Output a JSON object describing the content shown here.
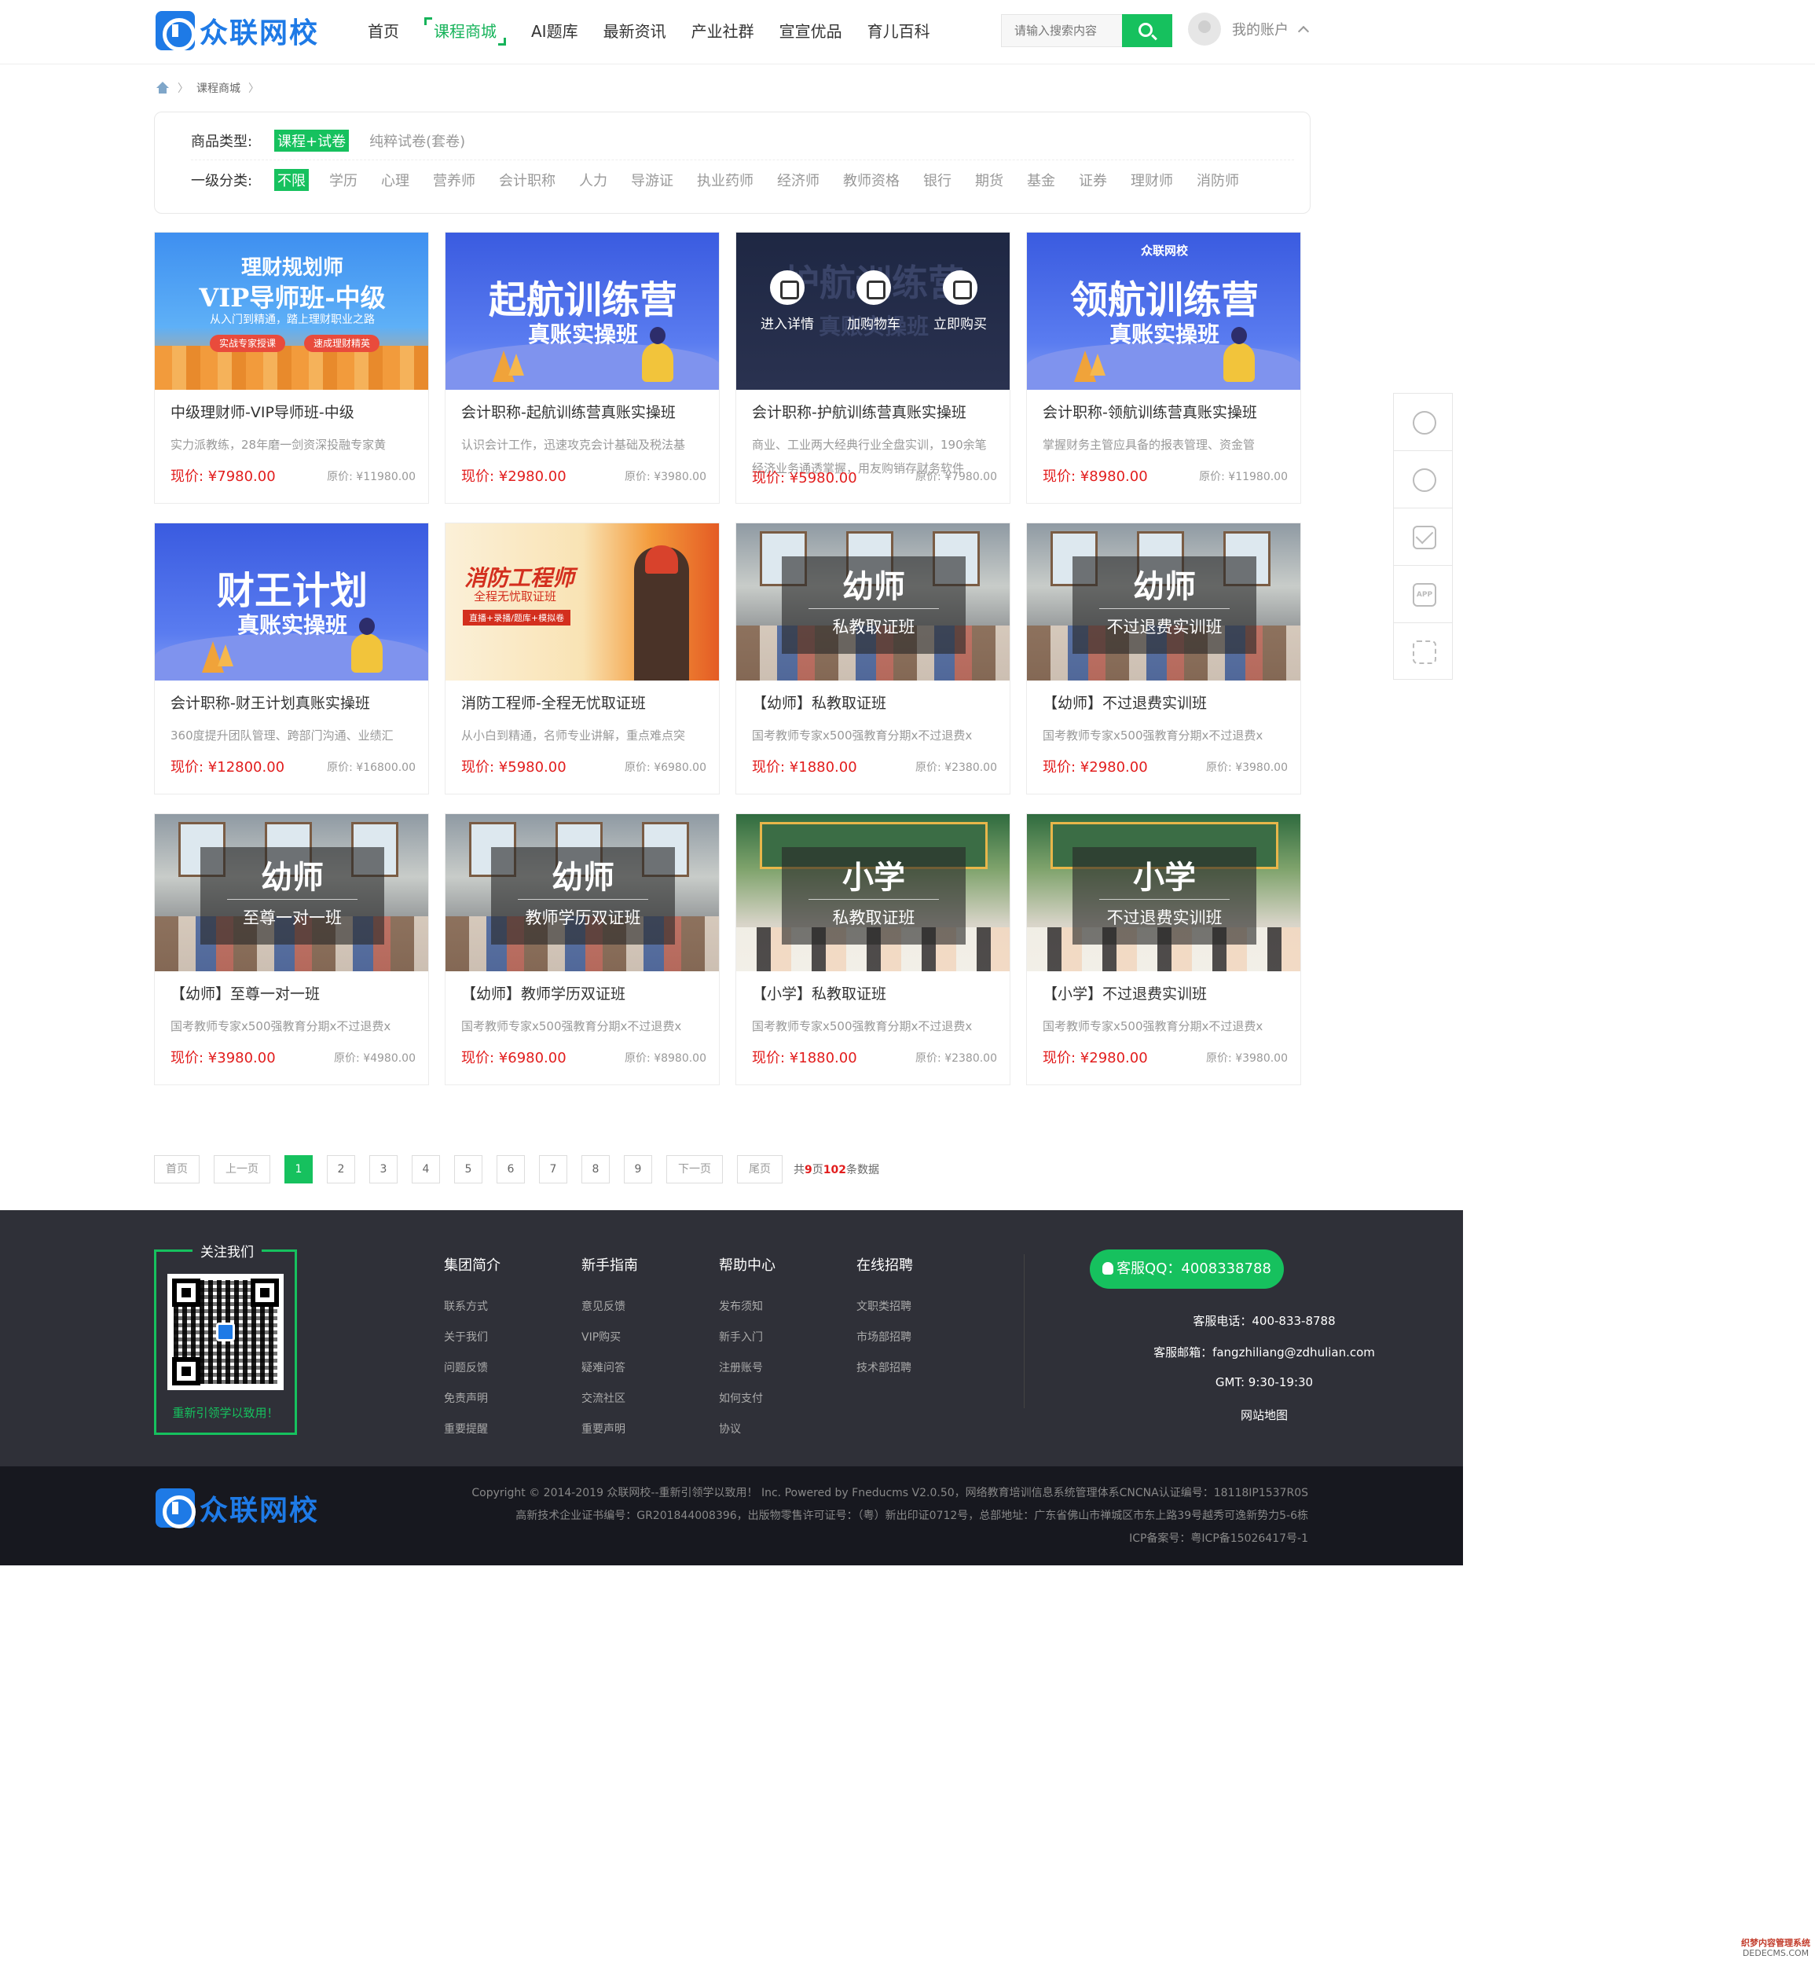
{
  "header": {
    "logo_text": "众联网校",
    "nav": [
      "首页",
      "课程商城",
      "AI题库",
      "最新资讯",
      "产业社群",
      "宣宣优品",
      "育儿百科"
    ],
    "active_nav": "课程商城",
    "search_placeholder": "请输入搜索内容",
    "account_label": "我的账户"
  },
  "breadcrumb": {
    "current": "课程商城",
    "sep": "〉"
  },
  "filter": {
    "type_label": "商品类型:",
    "type_options": [
      "课程+试卷",
      "纯粹试卷(套卷)"
    ],
    "category_label": "一级分类:",
    "category_options": [
      "不限",
      "学历",
      "心理",
      "营养师",
      "会计职称",
      "人力",
      "导游证",
      "执业药师",
      "经济师",
      "教师资格",
      "银行",
      "期货",
      "基金",
      "证券",
      "理财师",
      "消防师"
    ]
  },
  "products": [
    {
      "title": "中级理财师-VIP导师班-中级",
      "desc": "实力派教练，28年磨一剑资深投融专家黄",
      "price": "现价: ¥7980.00",
      "orig": "原价: ¥11980.00",
      "banner": {
        "style": "vip",
        "line1": "理财规划师",
        "line2": "VIP导师班-中级",
        "line3": "从入门到精通，踏上理财职业之路",
        "tag1": "实战专家授课",
        "tag2": "速成理财精英"
      }
    },
    {
      "title": "会计职称-起航训练营真账实操班",
      "desc": "认识会计工作，迅速攻克会计基础及税法基",
      "price": "现价: ¥2980.00",
      "orig": "原价: ¥3980.00",
      "banner": {
        "style": "blue",
        "line1": "起航训练营",
        "line2": "真账实操班"
      }
    },
    {
      "title": "会计职称-护航训练营真账实操班",
      "desc": "商业、工业两大经典行业全盘实训，190余笔经济业务通透掌握，用友购销存财务软件",
      "price": "现价: ¥5980.00",
      "orig": "原价: ¥7980.00",
      "banner": {
        "style": "dark",
        "line1": "护航训练营",
        "line2": "真账实操班",
        "actions": [
          "进入详情",
          "加购物车",
          "立即购买"
        ]
      }
    },
    {
      "title": "会计职称-领航训练营真账实操班",
      "desc": "掌握财务主管应具备的报表管理、资金管",
      "price": "现价: ¥8980.00",
      "orig": "原价: ¥11980.00",
      "banner": {
        "style": "blue",
        "brand": "众联网校",
        "line1": "领航训练营",
        "line2": "真账实操班"
      }
    },
    {
      "title": "会计职称-财王计划真账实操班",
      "desc": "360度提升团队管理、跨部门沟通、业绩汇",
      "price": "现价: ¥12800.00",
      "orig": "原价: ¥16800.00",
      "banner": {
        "style": "blue",
        "line1": "财王计划",
        "line2": "真账实操班"
      }
    },
    {
      "title": "消防工程师-全程无忧取证班",
      "desc": "从小白到精通，名师专业讲解，重点难点突",
      "price": "现价: ¥5980.00",
      "orig": "原价: ¥6980.00",
      "banner": {
        "style": "fire",
        "line1": "消防工程师",
        "line2": "全程无忧取证班",
        "line3": "直播+录播/题库+模拟卷"
      }
    },
    {
      "title": "【幼师】私教取证班",
      "desc": "国考教师专家x500强教育分期x不过退费x",
      "price": "现价: ¥1880.00",
      "orig": "原价: ¥2380.00",
      "banner": {
        "style": "class",
        "line1": "幼师",
        "line2": "私教取证班"
      }
    },
    {
      "title": "【幼师】不过退费实训班",
      "desc": "国考教师专家x500强教育分期x不过退费x",
      "price": "现价: ¥2980.00",
      "orig": "原价: ¥3980.00",
      "banner": {
        "style": "class",
        "line1": "幼师",
        "line2": "不过退费实训班"
      }
    },
    {
      "title": "【幼师】至尊一对一班",
      "desc": "国考教师专家x500强教育分期x不过退费x",
      "price": "现价: ¥3980.00",
      "orig": "原价: ¥4980.00",
      "banner": {
        "style": "class",
        "line1": "幼师",
        "line2": "至尊一对一班"
      }
    },
    {
      "title": "【幼师】教师学历双证班",
      "desc": "国考教师专家x500强教育分期x不过退费x",
      "price": "现价: ¥6980.00",
      "orig": "原价: ¥8980.00",
      "banner": {
        "style": "class",
        "line1": "幼师",
        "line2": "教师学历双证班"
      }
    },
    {
      "title": "【小学】私教取证班",
      "desc": "国考教师专家x500强教育分期x不过退费x",
      "price": "现价: ¥1880.00",
      "orig": "原价: ¥2380.00",
      "banner": {
        "style": "green",
        "line1": "小学",
        "line2": "私教取证班"
      }
    },
    {
      "title": "【小学】不过退费实训班",
      "desc": "国考教师专家x500强教育分期x不过退费x",
      "price": "现价: ¥2980.00",
      "orig": "原价: ¥3980.00",
      "banner": {
        "style": "green",
        "line1": "小学",
        "line2": "不过退费实训班"
      }
    }
  ],
  "pagination": {
    "first": "首页",
    "prev": "上一页",
    "pages": [
      "1",
      "2",
      "3",
      "4",
      "5",
      "6",
      "7",
      "8",
      "9"
    ],
    "current": "1",
    "next": "下一页",
    "last": "尾页",
    "summary_prefix": "共",
    "total_pages": "9",
    "summary_mid": "页",
    "total_items": "102",
    "summary_suffix": "条数据"
  },
  "sidebar": [
    "headset-icon",
    "edit-icon",
    "mail-icon",
    "app-icon",
    "qrcode-icon"
  ],
  "footer": {
    "follow_title": "关注我们",
    "follow_text": "重新引领学以致用！",
    "columns": [
      {
        "heading": "集团简介",
        "links": [
          "联系方式",
          "关于我们",
          "问题反馈",
          "免责声明",
          "重要提醒"
        ]
      },
      {
        "heading": "新手指南",
        "links": [
          "意见反馈",
          "VIP购买",
          "疑难问答",
          "交流社区",
          "重要声明"
        ]
      },
      {
        "heading": "帮助中心",
        "links": [
          "发布须知",
          "新手入门",
          "注册账号",
          "如何支付",
          "协议"
        ]
      },
      {
        "heading": "在线招聘",
        "links": [
          "文职类招聘",
          "市场部招聘",
          "技术部招聘"
        ]
      }
    ],
    "qq": "客服QQ：4008338788",
    "phone": "客服电话：400-833-8788",
    "email": "客服邮箱：fangzhiliang@zdhulian.com",
    "hours": "GMT: 9:30-19:30",
    "sitemap": "网站地图"
  },
  "bottom": {
    "logo_text": "众联网校",
    "line1": "Copyright © 2014-2019 众联网校--重新引领学以致用！ Inc. Powered by Fneducms V2.0.50，网络教育培训信息系统管理体系CNCNA认证编号：18118IP1537R0S",
    "line2": "高新技术企业证书编号：GR201844008396，出版物零售许可证号：（粤）新出印证0712号，总部地址：广东省佛山市禅城区市东上路39号越秀可逸新势力5-6栋",
    "line3": "ICP备案号：粤ICP备15026417号-1"
  },
  "watermark": {
    "line1": "织梦内容管理系统",
    "line2": "DEDECMS.COM"
  },
  "colors": {
    "accent": "#16c15e",
    "brand": "#1e7ae6",
    "price": "#e21d1d",
    "footer_bg": "#2f3038",
    "footer_bottom": "#17181f"
  }
}
